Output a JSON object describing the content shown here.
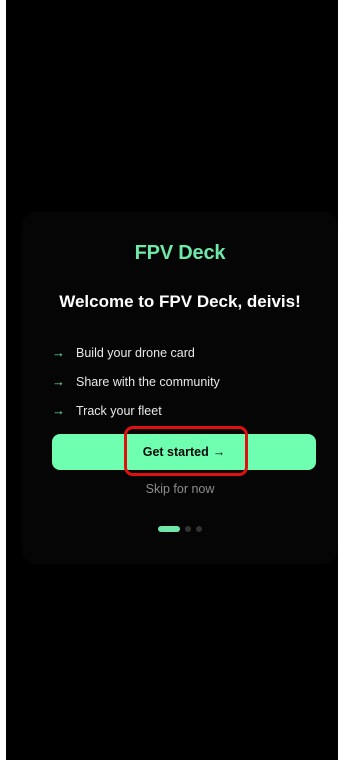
{
  "onboarding": {
    "brand": "FPV Deck",
    "welcome": "Welcome to FPV Deck, deivis!",
    "features": [
      {
        "icon": "arrow-right-icon",
        "label": "Build your drone card"
      },
      {
        "icon": "arrow-right-icon",
        "label": "Share with the community"
      },
      {
        "icon": "arrow-right-icon",
        "label": "Track your fleet"
      }
    ],
    "cta_label": "Get started",
    "cta_arrow": "→",
    "skip_label": "Skip for now",
    "pagination": {
      "total": 3,
      "current": 1
    }
  },
  "colors": {
    "accent": "#6ee7a8",
    "button": "#6effb0",
    "background": "#000000",
    "highlight": "#e01010"
  }
}
